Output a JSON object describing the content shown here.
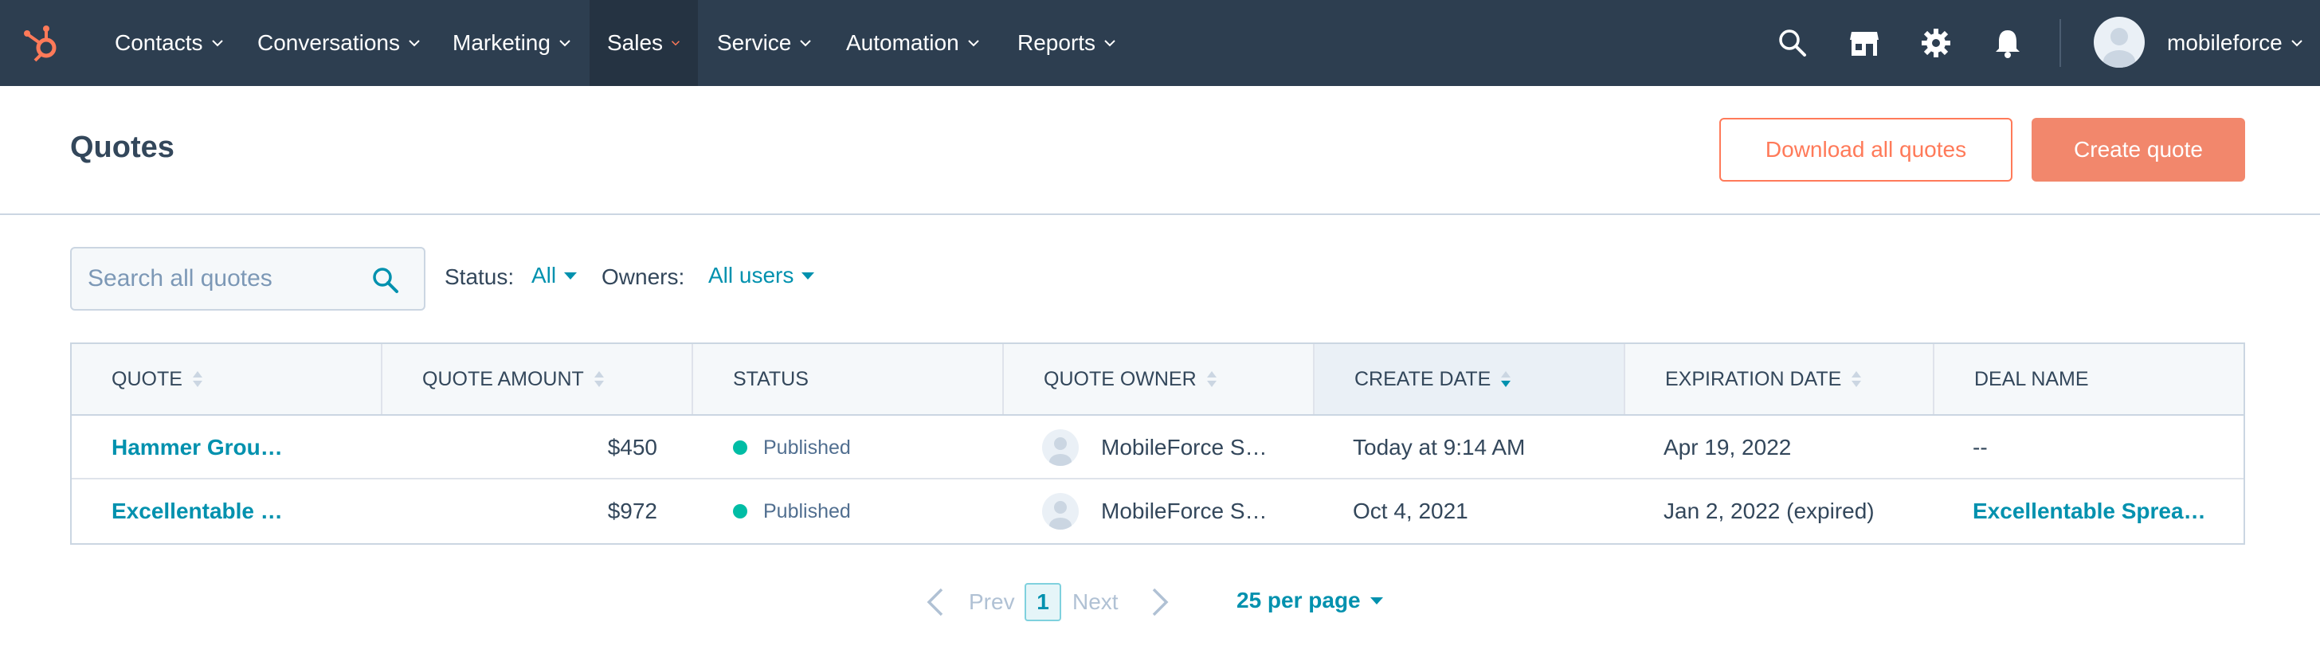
{
  "nav": {
    "items": [
      {
        "label": "Contacts"
      },
      {
        "label": "Conversations"
      },
      {
        "label": "Marketing"
      },
      {
        "label": "Sales"
      },
      {
        "label": "Service"
      },
      {
        "label": "Automation"
      },
      {
        "label": "Reports"
      }
    ],
    "active": "Sales",
    "user_name": "mobileforce",
    "icons": [
      "search-icon",
      "marketplace-icon",
      "settings-gear-icon",
      "notifications-bell-icon"
    ]
  },
  "header": {
    "title": "Quotes",
    "download_label": "Download all quotes",
    "create_label": "Create quote"
  },
  "filters": {
    "search_placeholder": "Search all quotes",
    "status_label": "Status:",
    "status_value": "All",
    "owners_label": "Owners:",
    "owners_value": "All users"
  },
  "table": {
    "columns": [
      "QUOTE",
      "QUOTE AMOUNT",
      "STATUS",
      "QUOTE OWNER",
      "CREATE DATE",
      "EXPIRATION DATE",
      "DEAL NAME"
    ],
    "sorted_column": "CREATE DATE",
    "rows": [
      {
        "quote": "Hammer Grou…",
        "amount": "$450",
        "status": "Published",
        "owner": "MobileForce S…",
        "create_date": "Today at 9:14 AM",
        "expiration_date": "Apr 19, 2022",
        "deal_name": "--"
      },
      {
        "quote": "Excellentable …",
        "amount": "$972",
        "status": "Published",
        "owner": "MobileForce S…",
        "create_date": "Oct 4, 2021",
        "expiration_date": "Jan 2, 2022 (expired)",
        "deal_name": "Excellentable Sprea…"
      }
    ]
  },
  "pagination": {
    "prev_label": "Prev",
    "current_page": "1",
    "next_label": "Next",
    "per_page_label": "25 per page"
  },
  "colors": {
    "nav_bg": "#2d3e50",
    "accent_orange": "#ff7a59",
    "link_teal": "#0091ae",
    "status_published": "#00bda5"
  }
}
